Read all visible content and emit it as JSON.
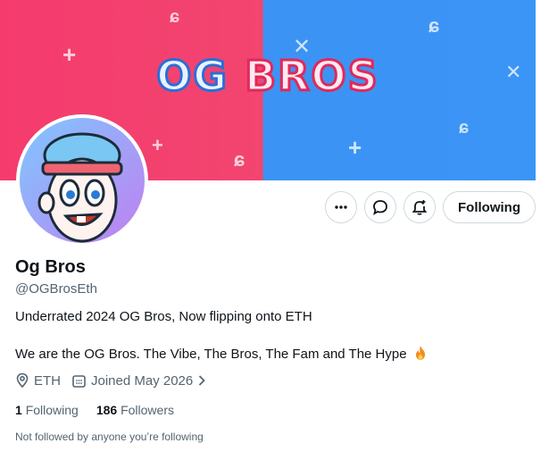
{
  "banner": {
    "title_word1": "OG",
    "title_word2": "BROS"
  },
  "profile": {
    "name": "Og Bros",
    "handle": "@OGBrosEth",
    "bio_line1": "Underrated 2024 OG Bros, Now flipping onto ETH",
    "bio_line2": "We are the OG Bros. The Vibe, The Bros, The Fam and The Hype",
    "bio_emoji": "fire-icon",
    "location": "ETH",
    "joined": "Joined May 2026",
    "following_count": "1",
    "following_label": "Following",
    "followers_count": "186",
    "followers_label": "Followers",
    "followed_by_note": "Not followed by anyone you’re following"
  },
  "actions": {
    "more_icon": "more-icon",
    "message_icon": "message-icon",
    "notify_icon": "notification-bell-icon",
    "follow_label": "Following"
  },
  "colors": {
    "banner_left": "#f2456f",
    "banner_right": "#3b95f6",
    "text": "#0f1419",
    "secondary": "#536471"
  }
}
